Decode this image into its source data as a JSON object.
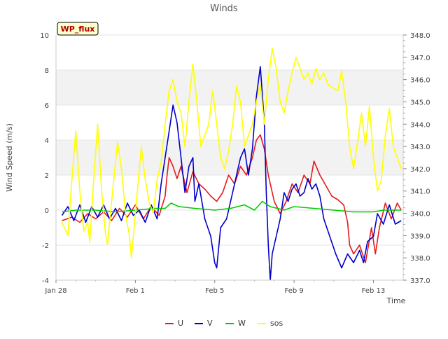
{
  "chart_data": {
    "type": "line",
    "title": "Winds",
    "xlabel": "Time",
    "ylabel": "Wind Speed (m/s)",
    "badge": "WP_flux",
    "x_ticks": [
      "Jan 28",
      "Feb 1",
      "Feb 5",
      "Feb 9",
      "Feb 13"
    ],
    "x_range_days": [
      0,
      17.5
    ],
    "ylim_left": [
      -4,
      10
    ],
    "y_ticks_left": [
      "-4",
      "-2",
      "0",
      "2",
      "4",
      "6",
      "8",
      "10"
    ],
    "ylim_right": [
      337.0,
      348.0
    ],
    "y_ticks_right": [
      "337.0",
      "338.0",
      "339.0",
      "340.0",
      "341.0",
      "342.0",
      "343.0",
      "344.0",
      "345.0",
      "346.0",
      "347.0",
      "348.0"
    ],
    "legend_position": "bottom-center",
    "grid": "horizontal bands",
    "series": [
      {
        "name": "U",
        "color": "#e41a1c",
        "axis": "left",
        "points": [
          [
            0.3,
            -0.6
          ],
          [
            0.8,
            -0.4
          ],
          [
            1.2,
            -0.7
          ],
          [
            1.6,
            -0.2
          ],
          [
            2.0,
            -0.5
          ],
          [
            2.4,
            -0.1
          ],
          [
            2.8,
            -0.6
          ],
          [
            3.2,
            0.1
          ],
          [
            3.6,
            -0.4
          ],
          [
            4.0,
            0.3
          ],
          [
            4.4,
            -0.5
          ],
          [
            4.8,
            0.2
          ],
          [
            5.2,
            -0.3
          ],
          [
            5.5,
            0.8
          ],
          [
            5.6,
            2.0
          ],
          [
            5.7,
            3.0
          ],
          [
            5.9,
            2.5
          ],
          [
            6.1,
            1.8
          ],
          [
            6.3,
            2.5
          ],
          [
            6.6,
            1.0
          ],
          [
            6.9,
            2.2
          ],
          [
            7.2,
            1.5
          ],
          [
            7.5,
            1.2
          ],
          [
            7.8,
            0.8
          ],
          [
            8.1,
            0.5
          ],
          [
            8.4,
            1.0
          ],
          [
            8.7,
            2.0
          ],
          [
            9.0,
            1.5
          ],
          [
            9.3,
            2.5
          ],
          [
            9.6,
            2.0
          ],
          [
            9.9,
            3.0
          ],
          [
            10.1,
            4.0
          ],
          [
            10.3,
            4.3
          ],
          [
            10.5,
            3.5
          ],
          [
            10.7,
            2.0
          ],
          [
            11.0,
            0.5
          ],
          [
            11.3,
            -0.2
          ],
          [
            11.6,
            0.5
          ],
          [
            11.9,
            1.5
          ],
          [
            12.2,
            1.0
          ],
          [
            12.5,
            2.0
          ],
          [
            12.8,
            1.5
          ],
          [
            13.0,
            2.8
          ],
          [
            13.3,
            2.0
          ],
          [
            13.6,
            1.4
          ],
          [
            13.9,
            0.8
          ],
          [
            14.2,
            0.6
          ],
          [
            14.5,
            0.3
          ],
          [
            14.7,
            -0.7
          ],
          [
            14.8,
            -2.0
          ],
          [
            15.0,
            -2.5
          ],
          [
            15.3,
            -2.0
          ],
          [
            15.6,
            -3.0
          ],
          [
            15.9,
            -1.0
          ],
          [
            16.1,
            -2.5
          ],
          [
            16.3,
            -1.0
          ],
          [
            16.6,
            0.4
          ],
          [
            16.9,
            -0.5
          ],
          [
            17.2,
            0.4
          ],
          [
            17.4,
            0.0
          ]
        ]
      },
      {
        "name": "V",
        "color": "#0000cc",
        "axis": "left",
        "points": [
          [
            0.3,
            -0.3
          ],
          [
            0.6,
            0.2
          ],
          [
            0.9,
            -0.6
          ],
          [
            1.2,
            0.3
          ],
          [
            1.5,
            -0.7
          ],
          [
            1.8,
            0.2
          ],
          [
            2.1,
            -0.4
          ],
          [
            2.4,
            0.3
          ],
          [
            2.7,
            -0.5
          ],
          [
            3.0,
            0.1
          ],
          [
            3.3,
            -0.6
          ],
          [
            3.6,
            0.4
          ],
          [
            3.9,
            -0.3
          ],
          [
            4.2,
            0.0
          ],
          [
            4.5,
            -0.7
          ],
          [
            4.8,
            0.3
          ],
          [
            5.1,
            -0.5
          ],
          [
            5.3,
            1.5
          ],
          [
            5.5,
            3.0
          ],
          [
            5.7,
            4.5
          ],
          [
            5.9,
            6.0
          ],
          [
            6.1,
            5.0
          ],
          [
            6.3,
            3.0
          ],
          [
            6.5,
            1.0
          ],
          [
            6.7,
            2.5
          ],
          [
            6.9,
            3.0
          ],
          [
            7.0,
            0.5
          ],
          [
            7.2,
            1.5
          ],
          [
            7.5,
            -0.5
          ],
          [
            7.8,
            -1.5
          ],
          [
            8.0,
            -3.0
          ],
          [
            8.1,
            -3.3
          ],
          [
            8.3,
            -1.0
          ],
          [
            8.6,
            -0.5
          ],
          [
            8.9,
            1.0
          ],
          [
            9.1,
            2.0
          ],
          [
            9.3,
            3.0
          ],
          [
            9.5,
            3.5
          ],
          [
            9.7,
            2.0
          ],
          [
            9.9,
            3.5
          ],
          [
            10.1,
            6.5
          ],
          [
            10.3,
            8.2
          ],
          [
            10.5,
            5.0
          ],
          [
            10.6,
            1.0
          ],
          [
            10.7,
            -2.0
          ],
          [
            10.8,
            -4.0
          ],
          [
            10.9,
            -2.5
          ],
          [
            11.1,
            -1.5
          ],
          [
            11.3,
            -0.5
          ],
          [
            11.5,
            1.0
          ],
          [
            11.7,
            0.5
          ],
          [
            11.9,
            1.2
          ],
          [
            12.1,
            1.5
          ],
          [
            12.3,
            0.8
          ],
          [
            12.5,
            1.0
          ],
          [
            12.7,
            1.8
          ],
          [
            12.9,
            1.2
          ],
          [
            13.1,
            1.5
          ],
          [
            13.3,
            0.8
          ],
          [
            13.5,
            -0.5
          ],
          [
            13.8,
            -1.5
          ],
          [
            14.1,
            -2.5
          ],
          [
            14.4,
            -3.3
          ],
          [
            14.7,
            -2.5
          ],
          [
            15.0,
            -3.0
          ],
          [
            15.3,
            -2.3
          ],
          [
            15.5,
            -3.0
          ],
          [
            15.7,
            -1.8
          ],
          [
            16.0,
            -1.5
          ],
          [
            16.2,
            -0.2
          ],
          [
            16.5,
            -0.8
          ],
          [
            16.8,
            0.3
          ],
          [
            17.1,
            -0.8
          ],
          [
            17.4,
            -0.6
          ]
        ]
      },
      {
        "name": "W",
        "color": "#00cc00",
        "axis": "left",
        "points": [
          [
            0.3,
            -0.1
          ],
          [
            1.0,
            0.0
          ],
          [
            2.0,
            0.0
          ],
          [
            3.0,
            -0.1
          ],
          [
            4.0,
            0.0
          ],
          [
            5.0,
            0.1
          ],
          [
            5.5,
            0.1
          ],
          [
            5.8,
            0.4
          ],
          [
            6.2,
            0.2
          ],
          [
            7.0,
            0.1
          ],
          [
            8.0,
            0.0
          ],
          [
            8.8,
            0.1
          ],
          [
            9.5,
            0.3
          ],
          [
            10.0,
            0.0
          ],
          [
            10.4,
            0.5
          ],
          [
            10.8,
            0.2
          ],
          [
            11.5,
            0.0
          ],
          [
            12.0,
            0.2
          ],
          [
            13.0,
            0.1
          ],
          [
            14.0,
            0.0
          ],
          [
            15.0,
            -0.1
          ],
          [
            15.5,
            -0.1
          ],
          [
            16.0,
            -0.1
          ],
          [
            16.5,
            0.0
          ],
          [
            17.4,
            0.0
          ]
        ]
      },
      {
        "name": "sos",
        "color": "#ffff00",
        "axis": "right",
        "points": [
          [
            0.3,
            339.6
          ],
          [
            0.6,
            339.0
          ],
          [
            0.8,
            341.5
          ],
          [
            1.0,
            343.7
          ],
          [
            1.2,
            341.0
          ],
          [
            1.4,
            339.2
          ],
          [
            1.6,
            339.6
          ],
          [
            1.7,
            338.7
          ],
          [
            1.9,
            341.5
          ],
          [
            2.1,
            344.0
          ],
          [
            2.3,
            341.0
          ],
          [
            2.5,
            339.0
          ],
          [
            2.6,
            338.6
          ],
          [
            2.8,
            340.5
          ],
          [
            3.1,
            343.2
          ],
          [
            3.3,
            342.0
          ],
          [
            3.5,
            340.0
          ],
          [
            3.7,
            339.0
          ],
          [
            3.8,
            338.0
          ],
          [
            4.0,
            340.0
          ],
          [
            4.3,
            343.0
          ],
          [
            4.5,
            341.5
          ],
          [
            4.7,
            340.5
          ],
          [
            4.9,
            340.0
          ],
          [
            5.1,
            341.5
          ],
          [
            5.3,
            342.3
          ],
          [
            5.5,
            344.0
          ],
          [
            5.7,
            345.5
          ],
          [
            5.9,
            346.0
          ],
          [
            6.1,
            345.0
          ],
          [
            6.3,
            344.5
          ],
          [
            6.5,
            343.0
          ],
          [
            6.7,
            345.0
          ],
          [
            6.9,
            346.7
          ],
          [
            7.1,
            345.0
          ],
          [
            7.3,
            343.0
          ],
          [
            7.5,
            343.5
          ],
          [
            7.7,
            344.0
          ],
          [
            7.9,
            345.5
          ],
          [
            8.1,
            344.0
          ],
          [
            8.3,
            342.5
          ],
          [
            8.5,
            342.0
          ],
          [
            8.7,
            342.8
          ],
          [
            8.9,
            344.0
          ],
          [
            9.1,
            345.7
          ],
          [
            9.3,
            345.0
          ],
          [
            9.5,
            343.0
          ],
          [
            9.7,
            343.5
          ],
          [
            9.9,
            344.0
          ],
          [
            10.1,
            345.0
          ],
          [
            10.3,
            345.8
          ],
          [
            10.5,
            344.0
          ],
          [
            10.7,
            346.0
          ],
          [
            10.9,
            347.4
          ],
          [
            11.1,
            346.5
          ],
          [
            11.3,
            345.0
          ],
          [
            11.5,
            344.5
          ],
          [
            11.7,
            345.5
          ],
          [
            11.9,
            346.3
          ],
          [
            12.1,
            347.0
          ],
          [
            12.3,
            346.5
          ],
          [
            12.5,
            346.0
          ],
          [
            12.7,
            346.3
          ],
          [
            12.9,
            345.8
          ],
          [
            13.1,
            346.5
          ],
          [
            13.3,
            346.0
          ],
          [
            13.5,
            346.3
          ],
          [
            13.7,
            345.8
          ],
          [
            14.0,
            345.6
          ],
          [
            14.2,
            345.5
          ],
          [
            14.4,
            346.4
          ],
          [
            14.6,
            345.0
          ],
          [
            14.8,
            343.0
          ],
          [
            15.0,
            342.0
          ],
          [
            15.2,
            343.2
          ],
          [
            15.4,
            344.5
          ],
          [
            15.6,
            343.0
          ],
          [
            15.8,
            344.8
          ],
          [
            16.0,
            342.5
          ],
          [
            16.2,
            341.0
          ],
          [
            16.4,
            341.5
          ],
          [
            16.6,
            343.5
          ],
          [
            16.8,
            344.7
          ],
          [
            17.0,
            343.0
          ],
          [
            17.2,
            342.5
          ],
          [
            17.4,
            342.0
          ]
        ]
      }
    ]
  }
}
